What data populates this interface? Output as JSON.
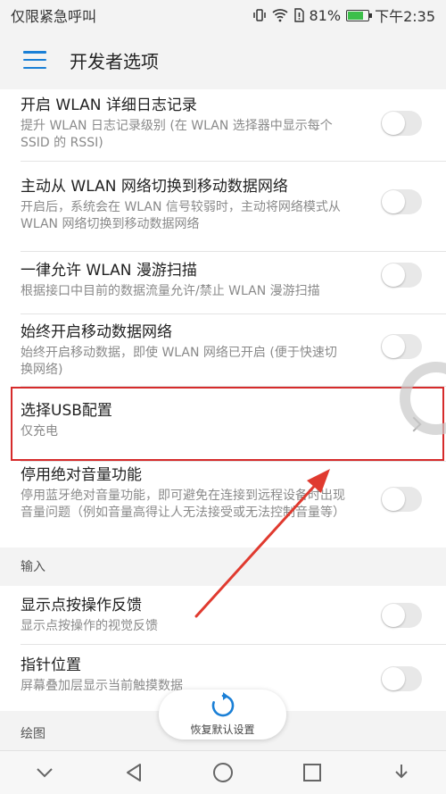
{
  "status_bar": {
    "carrier": "仅限紧急呼叫",
    "battery_percent": "81%",
    "battery_level": 0.81,
    "time": "下午2:35"
  },
  "app_bar": {
    "title": "开发者选项"
  },
  "settings": [
    {
      "title": "开启 WLAN 详细日志记录",
      "summary": "提升 WLAN 日志记录级别 (在 WLAN 选择器中显示每个 SSID 的 RSSI)",
      "control": "toggle",
      "enabled": false
    },
    {
      "title": "主动从 WLAN 网络切换到移动数据网络",
      "summary": "开启后，系统会在 WLAN 信号较弱时，主动将网络模式从 WLAN 网络切换到移动数据网络",
      "control": "toggle",
      "enabled": false
    },
    {
      "title": "一律允许 WLAN 漫游扫描",
      "summary": "根据接口中目前的数据流量允许/禁止 WLAN 漫游扫描",
      "control": "toggle",
      "enabled": false
    },
    {
      "title": "始终开启移动数据网络",
      "summary": "始终开启移动数据，即使 WLAN 网络已开启 (便于快速切换网络)",
      "control": "toggle",
      "enabled": false
    },
    {
      "title": "选择USB配置",
      "summary": "仅充电",
      "control": "chevron"
    },
    {
      "title": "停用绝对音量功能",
      "summary": "停用蓝牙绝对音量功能，即可避免在连接到远程设备时出现音量问题（例如音量高得让人无法接受或无法控制音量等）",
      "control": "toggle",
      "enabled": false
    }
  ],
  "section_input": {
    "header": "输入",
    "items": [
      {
        "title": "显示点按操作反馈",
        "summary": "显示点按操作的视觉反馈",
        "control": "toggle",
        "enabled": false
      },
      {
        "title": "指针位置",
        "summary": "屏幕叠加层显示当前触摸数据",
        "control": "toggle",
        "enabled": false
      }
    ]
  },
  "section_drawing": {
    "header": "绘图"
  },
  "floating_action": {
    "label": "恢复默认设置"
  },
  "colors": {
    "accent": "#1a7fd6",
    "highlight_box": "#d62b2b",
    "arrow": "#e03a2f"
  }
}
